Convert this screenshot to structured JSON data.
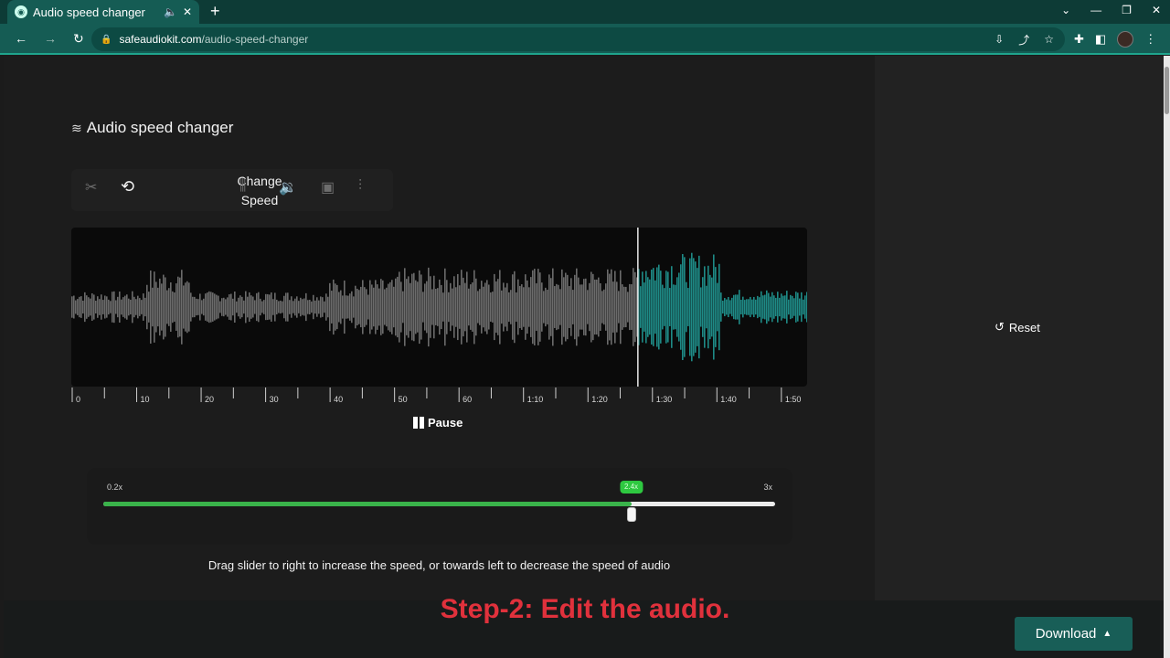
{
  "browser": {
    "tab_title": "Audio speed changer",
    "url_domain": "safeaudiokit.com",
    "url_path": "/audio-speed-changer"
  },
  "app": {
    "title": "Audio speed changer",
    "active_tool_label_line1": "Change",
    "active_tool_label_line2": "Speed",
    "tool_icons": [
      "scissors-icon",
      "speed-icon",
      "equalizer-bars-icon",
      "volume-icon",
      "speaker-icon",
      "mixer-sliders-icon"
    ]
  },
  "timeline": {
    "labels": [
      "0",
      "10",
      "20",
      "30",
      "40",
      "50",
      "60",
      "1:10",
      "1:20",
      "1:30",
      "1:40",
      "1:50"
    ],
    "playhead_fraction": 0.77,
    "duration_seconds": 113
  },
  "player": {
    "pause_label": "Pause"
  },
  "slider": {
    "min_label": "0.2x",
    "max_label": "3x",
    "value_label": "2.4x",
    "min": 0.2,
    "max": 3.0,
    "value": 2.4
  },
  "hint_text": "Drag slider to right to increase the speed, or towards left to decrease the speed of audio",
  "side": {
    "reset_label": "Reset"
  },
  "overlay_text": "Step-2: Edit the audio.",
  "footer": {
    "download_label": "Download"
  },
  "colors": {
    "played_wave": "#6b6b6b",
    "unplayed_wave": "#1e8a86",
    "slider_fill": "#3ab34a",
    "accent": "#185e57"
  }
}
